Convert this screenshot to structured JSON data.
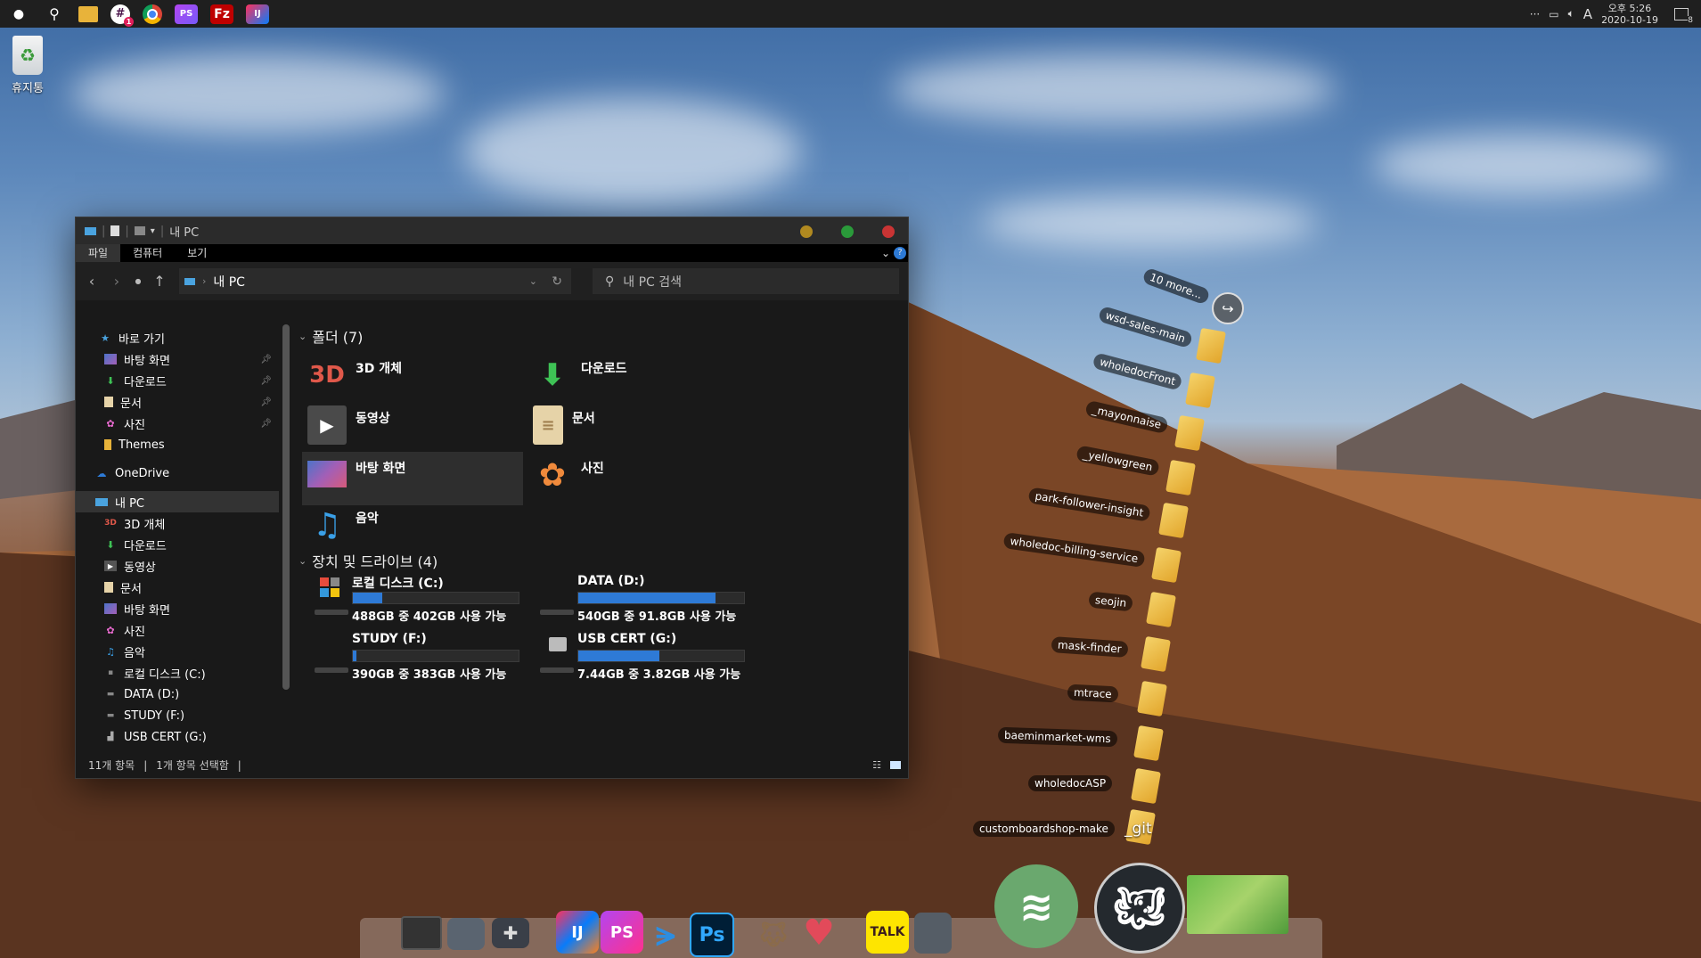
{
  "topbar": {
    "apps": [
      "apple-icon",
      "search-icon",
      "file-explorer-icon",
      "slack-icon",
      "chrome-icon",
      "phpstorm-icon",
      "filezilla-icon",
      "intellij-icon"
    ],
    "slack_badge": "1",
    "tray_more": "···",
    "ime": "A",
    "time": "오후 5:26",
    "date": "2020-10-19",
    "notif_count": "8"
  },
  "desktop": {
    "recycle_label": "휴지통"
  },
  "explorer": {
    "title": "내 PC",
    "ribbon": [
      "파일",
      "컴퓨터",
      "보기"
    ],
    "address": "내 PC",
    "search_placeholder": "내 PC 검색",
    "nav": {
      "quick_access": "바로 가기",
      "quick_items": [
        {
          "label": "바탕 화면",
          "pinned": true
        },
        {
          "label": "다운로드",
          "pinned": true
        },
        {
          "label": "문서",
          "pinned": true
        },
        {
          "label": "사진",
          "pinned": true
        },
        {
          "label": "Themes",
          "pinned": false
        }
      ],
      "onedrive": "OneDrive",
      "this_pc": "내 PC",
      "pc_items": [
        "3D 개체",
        "다운로드",
        "동영상",
        "문서",
        "바탕 화면",
        "사진",
        "음악",
        "로컬 디스크 (C:)",
        "DATA (D:)",
        "STUDY (F:)",
        "USB CERT (G:)"
      ]
    },
    "folders_header": "폴더 (7)",
    "folders": [
      "3D 개체",
      "다운로드",
      "동영상",
      "문서",
      "바탕 화면",
      "사진",
      "음악"
    ],
    "drives_header": "장치 및 드라이브 (4)",
    "drives": [
      {
        "name": "로컬 디스크 (C:)",
        "free": "488GB 중 402GB 사용 가능",
        "used_fraction": 0.18
      },
      {
        "name": "DATA (D:)",
        "free": "540GB 중 91.8GB 사용 가능",
        "used_fraction": 0.83
      },
      {
        "name": "STUDY (F:)",
        "free": "390GB 중 383GB 사용 가능",
        "used_fraction": 0.02
      },
      {
        "name": "USB CERT (G:)",
        "free": "7.44GB 중 3.82GB 사용 가능",
        "used_fraction": 0.49
      }
    ],
    "status_count": "11개 항목",
    "status_selected": "1개 항목 선택함"
  },
  "stack": {
    "more": "10 more...",
    "items": [
      "wsd-sales-main",
      "wholedocFront",
      "_mayonnaise",
      "_yellowgreen",
      "park-follower-insight",
      "wholedoc-billing-service",
      "seojin",
      "mask-finder",
      "mtrace",
      "baeminmarket-wms",
      "wholedocASP",
      "customboardshop-make"
    ],
    "git_label": "_git"
  },
  "dock": {
    "talk_label": "TALK",
    "apps": [
      "monitor-icon",
      "files-icon",
      "gamepad-icon",
      "intellij-icon",
      "phpstorm-icon",
      "vscode-icon",
      "photoshop-icon",
      "gimp-icon",
      "heart-icon",
      "kakaotalk-icon",
      "trash-icon",
      "spotify-icon",
      "github-icon",
      "game-thumbnail"
    ]
  }
}
